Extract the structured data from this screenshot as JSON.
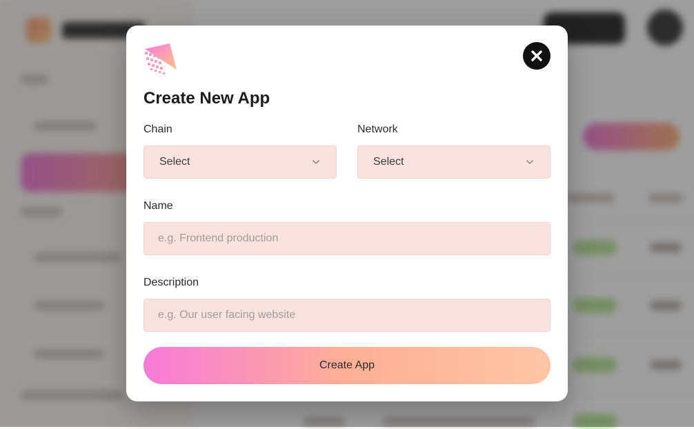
{
  "modal": {
    "title": "Create New App",
    "close_icon": "close-icon",
    "logo_icon": "app-logo-icon",
    "chain": {
      "label": "Chain",
      "value": "Select"
    },
    "network": {
      "label": "Network",
      "value": "Select"
    },
    "name": {
      "label": "Name",
      "placeholder": "e.g. Frontend production"
    },
    "description": {
      "label": "Description",
      "placeholder": "e.g. Our user facing website"
    },
    "submit_label": "Create App"
  },
  "colors": {
    "input_bg": "#f8e3de",
    "button_gradient_start": "#f77ad9",
    "button_gradient_end": "#fdc5a6",
    "close_button": "#111111"
  }
}
